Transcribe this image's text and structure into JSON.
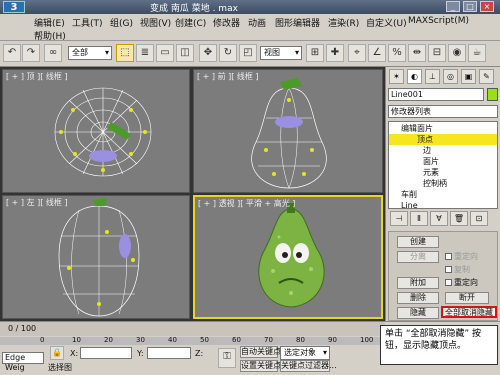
{
  "app": {
    "title": "变成 南瓜 菜地 . max",
    "logo": "3"
  },
  "menu": {
    "items": [
      "编辑(E)",
      "工具(T)",
      "组(G)",
      "视图(V)",
      "创建(C)",
      "修改器",
      "动画",
      "图形编辑器",
      "渲染(R)",
      "自定义(U)",
      "MAXScript(M)",
      "帮助(H)"
    ]
  },
  "toolbar": {
    "selection_filter": "全部",
    "ref_coord": "视图"
  },
  "viewports": {
    "top_left": "[ + ] 顶 ][ 线框 ]",
    "top_right": "[ + ] 前 ][ 线框 ]",
    "bottom_left": "[ + ] 左 ][ 线框 ]",
    "bottom_right": "[ + ] 透视 ][ 平滑 + 高光 ]"
  },
  "panel": {
    "object_name": "Line001",
    "modifier_list": "修改器列表",
    "stack": [
      "编辑面片",
      "顶点",
      "边",
      "面片",
      "元素",
      "控制柄",
      "车削",
      "Line",
      "顶点"
    ],
    "buttons": {
      "create": "创建",
      "detach": "分离",
      "attach": "附加",
      "delete": "删除",
      "hide": "隐藏",
      "unhide_all": "全部取消隐藏",
      "break": "断开"
    },
    "checks": {
      "reorient": "重定向",
      "copy": "复制",
      "reorient2": "重定向"
    }
  },
  "status": {
    "frame": "0 / 100",
    "x_label": "X:",
    "y_label": "Y:",
    "z_label": "Z:",
    "auto_key": "自动关键点",
    "set_key": "设置关键点",
    "selected": "选定对象",
    "key_filters": "关键点过滤器...",
    "selection_msg": "选择图",
    "script": "Edge Weig",
    "ticks": [
      "0",
      "10",
      "20",
      "30",
      "40",
      "50",
      "60",
      "70",
      "80",
      "90",
      "100"
    ]
  },
  "tooltip": "单击 “全部取消隐藏” 按钮，显示隐藏顶点。",
  "colors": {
    "active_border": "#e8d61c",
    "highlight": "#f6e61f",
    "gourd": "#7cb342",
    "wire": "#ffffff",
    "vertex": "#e6e61c"
  }
}
